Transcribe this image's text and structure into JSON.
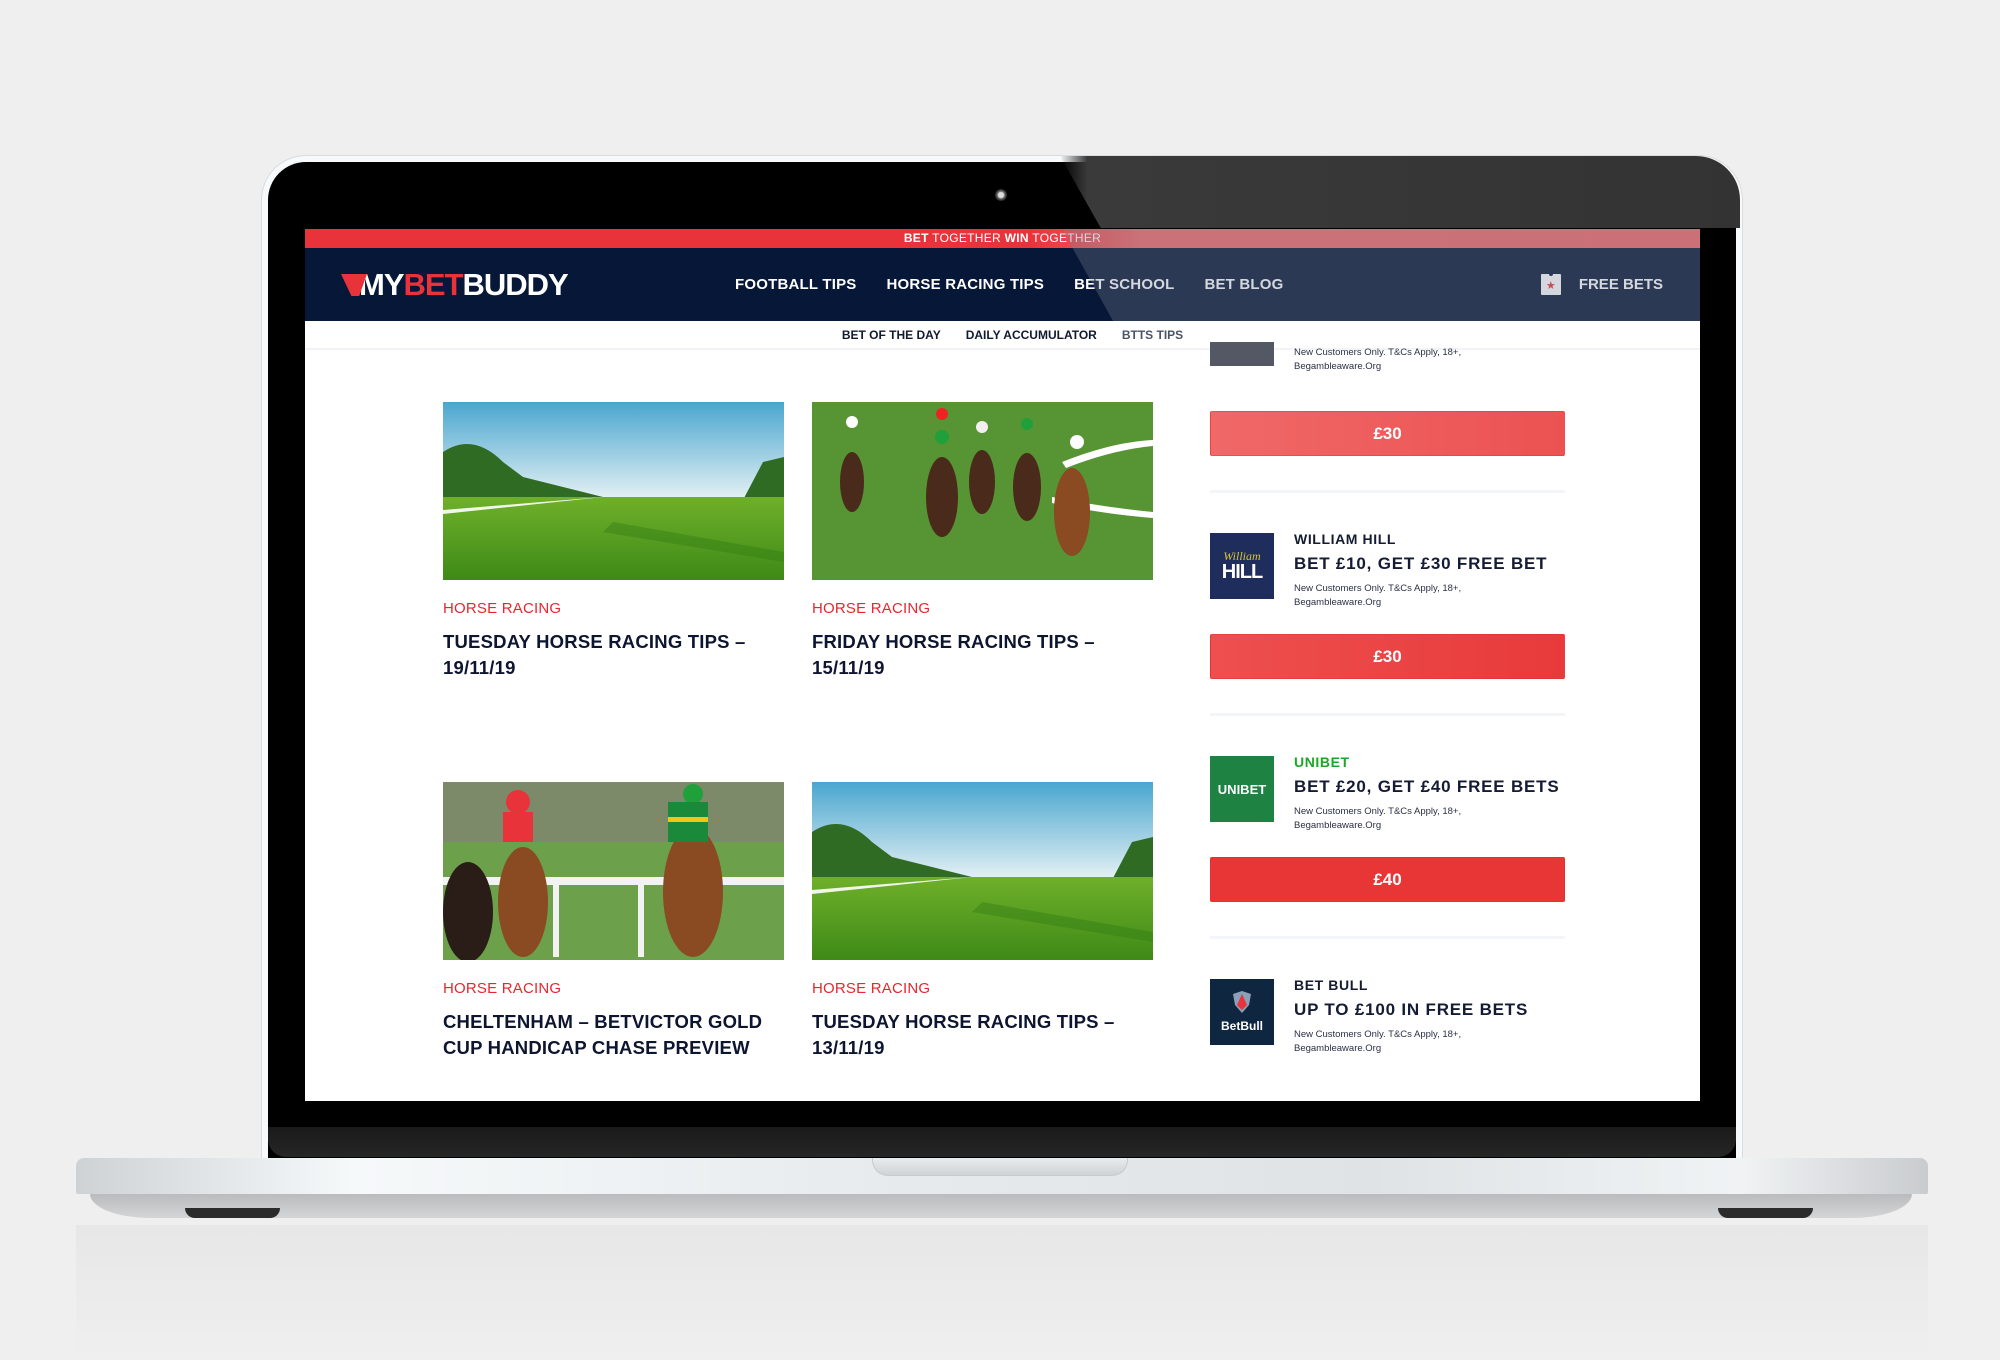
{
  "topbar": {
    "part1": "BET",
    "part2": " TOGETHER ",
    "part3": "WIN",
    "part4": " TOGETHER"
  },
  "header": {
    "logo": {
      "my": "MY",
      "bet": "BET",
      "buddy": "BUDDY"
    },
    "nav": [
      {
        "label": "FOOTBALL TIPS"
      },
      {
        "label": "HORSE RACING TIPS"
      },
      {
        "label": "BET SCHOOL"
      },
      {
        "label": "BET BLOG"
      }
    ],
    "free_bets_label": "FREE BETS",
    "free_bets_icon": "ticket-star-icon"
  },
  "subnav": [
    {
      "label": "BET OF THE DAY"
    },
    {
      "label": "DAILY ACCUMULATOR"
    },
    {
      "label": "BTTS TIPS"
    }
  ],
  "articles": [
    {
      "category": "HORSE RACING",
      "title": "TUESDAY HORSE RACING TIPS – 19/11/19",
      "image": "empty-racecourse-photo"
    },
    {
      "category": "HORSE RACING",
      "title": "FRIDAY HORSE RACING TIPS – 15/11/19",
      "image": "horses-racing-bend-photo"
    },
    {
      "category": "HORSE RACING",
      "title": "CHELTENHAM – BETVICTOR GOLD CUP HANDICAP CHASE PREVIEW",
      "image": "jockeys-racing-rail-photo"
    },
    {
      "category": "HORSE RACING",
      "title": "TUESDAY HORSE RACING TIPS – 13/11/19",
      "image": "empty-racecourse-photo"
    }
  ],
  "offers": [
    {
      "brand": "",
      "headline": "",
      "terms_line1": "New Customers Only. T&Cs Apply, 18+,",
      "terms_line2": "Begambleaware.Org",
      "cta": "£30",
      "cta_color": "#ee5a5a"
    },
    {
      "brand": "WILLIAM HILL",
      "brand_color": "#141b33",
      "headline": "BET £10, GET £30 FREE BET",
      "terms_line1": "New Customers Only. T&Cs Apply, 18+,",
      "terms_line2": "Begambleaware.Org",
      "cta": "£30",
      "cta_color": "#ec4646",
      "logo_text_top": "William",
      "logo_text_bottom": "HILL",
      "logo_bg": "#1e2d5c"
    },
    {
      "brand": "UNIBET",
      "brand_color": "#1aa826",
      "headline": "BET £20, GET £40 FREE BETS",
      "terms_line1": "New Customers Only. T&Cs Apply, 18+,",
      "terms_line2": "Begambleaware.Org",
      "cta": "£40",
      "cta_color": "#e83535",
      "logo_text": "UNIBET",
      "logo_bg": "#1e8242"
    },
    {
      "brand": "BET BULL",
      "brand_color": "#141b33",
      "headline": "UP TO £100 IN FREE BETS",
      "terms_line1": "New Customers Only. T&Cs Apply, 18+,",
      "terms_line2": "Begambleaware.Org",
      "logo_text": "BetBull",
      "logo_bg": "#0e2640"
    }
  ],
  "colors": {
    "brand_red": "#e8333b",
    "navy": "#061737",
    "category_red": "#e8262f"
  }
}
